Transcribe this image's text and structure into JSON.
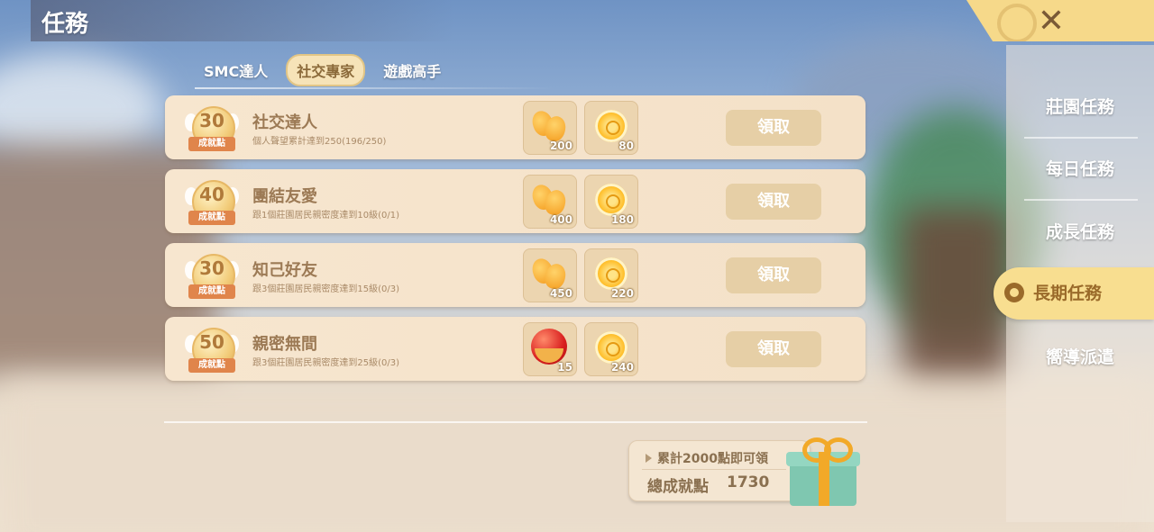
{
  "header": {
    "title": "任務"
  },
  "tabs": [
    {
      "label": "SMC達人",
      "active": false
    },
    {
      "label": "社交專家",
      "active": true
    },
    {
      "label": "遊戲高手",
      "active": false
    }
  ],
  "tasks": [
    {
      "points": "30",
      "badge_label": "成就點",
      "name": "社交達人",
      "desc": "個人聲望累計達到250(196/250)",
      "rewards": [
        {
          "icon": "orange-icon",
          "qty": "200"
        },
        {
          "icon": "coin-icon",
          "qty": "80"
        }
      ],
      "claim": "領取"
    },
    {
      "points": "40",
      "badge_label": "成就點",
      "name": "團結友愛",
      "desc": "跟1個莊園居民親密度達到10級(0/1)",
      "rewards": [
        {
          "icon": "orange-icon",
          "qty": "400"
        },
        {
          "icon": "coin-icon",
          "qty": "180"
        }
      ],
      "claim": "領取"
    },
    {
      "points": "30",
      "badge_label": "成就點",
      "name": "知己好友",
      "desc": "跟3個莊園居民親密度達到15級(0/3)",
      "rewards": [
        {
          "icon": "orange-icon",
          "qty": "450"
        },
        {
          "icon": "coin-icon",
          "qty": "220"
        }
      ],
      "claim": "領取"
    },
    {
      "points": "50",
      "badge_label": "成就點",
      "name": "親密無間",
      "desc": "跟3個莊園居民親密度達到25級(0/3)",
      "rewards": [
        {
          "icon": "red-bead-icon",
          "qty": "15"
        },
        {
          "icon": "coin-icon",
          "qty": "240"
        }
      ],
      "claim": "領取"
    }
  ],
  "points_box": {
    "tip": "累計2000點即可領",
    "label": "總成就點",
    "value": "1730"
  },
  "sidebar": [
    {
      "label": "莊園任務"
    },
    {
      "label": "每日任務"
    },
    {
      "label": "成長任務"
    },
    {
      "label": "長期任務",
      "active": true
    },
    {
      "label": "嚮導派遣"
    }
  ],
  "close": {
    "label": "✕"
  }
}
